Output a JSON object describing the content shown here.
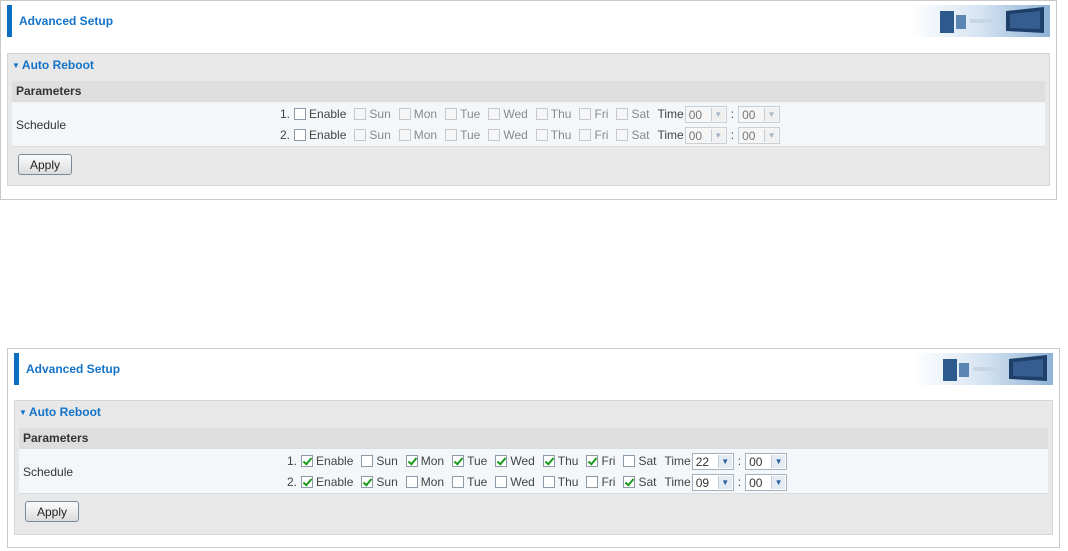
{
  "panels": [
    {
      "header_title": "Advanced Setup",
      "section_title": "Auto Reboot",
      "parameters_label": "Parameters",
      "schedule_label": "Schedule",
      "apply_label": "Apply",
      "rows": [
        {
          "index": "1.",
          "enable": false,
          "days": [
            {
              "label": "Sun",
              "checked": false
            },
            {
              "label": "Mon",
              "checked": false
            },
            {
              "label": "Tue",
              "checked": false
            },
            {
              "label": "Wed",
              "checked": false
            },
            {
              "label": "Thu",
              "checked": false
            },
            {
              "label": "Fri",
              "checked": false
            },
            {
              "label": "Sat",
              "checked": false
            }
          ],
          "time_label": "Time",
          "hour": "00",
          "minute": "00"
        },
        {
          "index": "2.",
          "enable": false,
          "days": [
            {
              "label": "Sun",
              "checked": false
            },
            {
              "label": "Mon",
              "checked": false
            },
            {
              "label": "Tue",
              "checked": false
            },
            {
              "label": "Wed",
              "checked": false
            },
            {
              "label": "Thu",
              "checked": false
            },
            {
              "label": "Fri",
              "checked": false
            },
            {
              "label": "Sat",
              "checked": false
            }
          ],
          "time_label": "Time",
          "hour": "00",
          "minute": "00"
        }
      ]
    },
    {
      "header_title": "Advanced Setup",
      "section_title": "Auto Reboot",
      "parameters_label": "Parameters",
      "schedule_label": "Schedule",
      "apply_label": "Apply",
      "rows": [
        {
          "index": "1.",
          "enable": true,
          "days": [
            {
              "label": "Sun",
              "checked": false
            },
            {
              "label": "Mon",
              "checked": true
            },
            {
              "label": "Tue",
              "checked": true
            },
            {
              "label": "Wed",
              "checked": true
            },
            {
              "label": "Thu",
              "checked": true
            },
            {
              "label": "Fri",
              "checked": true
            },
            {
              "label": "Sat",
              "checked": false
            }
          ],
          "time_label": "Time",
          "hour": "22",
          "minute": "00"
        },
        {
          "index": "2.",
          "enable": true,
          "days": [
            {
              "label": "Sun",
              "checked": true
            },
            {
              "label": "Mon",
              "checked": false
            },
            {
              "label": "Tue",
              "checked": false
            },
            {
              "label": "Wed",
              "checked": false
            },
            {
              "label": "Thu",
              "checked": false
            },
            {
              "label": "Fri",
              "checked": false
            },
            {
              "label": "Sat",
              "checked": true
            }
          ],
          "time_label": "Time",
          "hour": "09",
          "minute": "00"
        }
      ]
    }
  ],
  "enable_label": "Enable",
  "colors": {
    "accent": "#1473c8",
    "check": "#1a9a1a"
  }
}
